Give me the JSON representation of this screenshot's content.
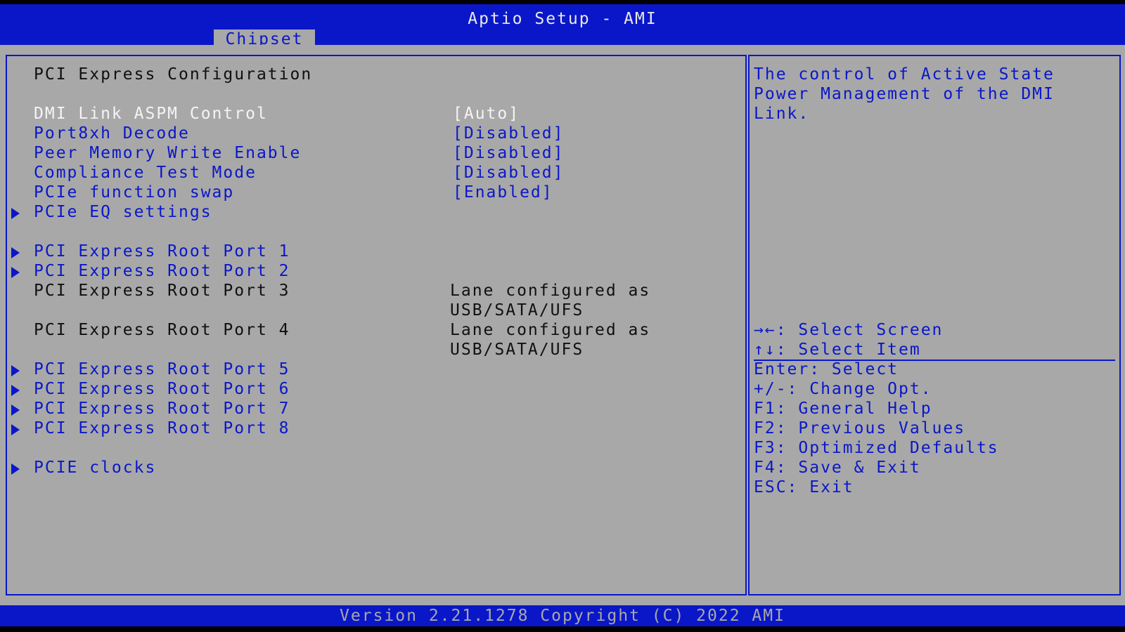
{
  "header": {
    "title": "Aptio Setup - AMI",
    "active_tab": "Chipset"
  },
  "page": {
    "heading": "PCI Express Configuration"
  },
  "settings": [
    {
      "label": "DMI Link ASPM Control",
      "value": "[Auto]"
    },
    {
      "label": "Port8xh Decode",
      "value": "[Disabled]"
    },
    {
      "label": "Peer Memory Write Enable",
      "value": "[Disabled]"
    },
    {
      "label": "Compliance Test Mode",
      "value": "[Disabled]"
    },
    {
      "label": "PCIe function swap",
      "value": "[Enabled]"
    }
  ],
  "submenus": {
    "eq_settings": "PCIe EQ settings",
    "port1": "PCI Express Root Port 1",
    "port2": "PCI Express Root Port 2",
    "port5": "PCI Express Root Port 5",
    "port6": "PCI Express Root Port 6",
    "port7": "PCI Express Root Port 7",
    "port8": "PCI Express Root Port 8",
    "clocks": "PCIE clocks"
  },
  "disabled_ports": [
    {
      "label": "PCI Express Root Port 3",
      "status_line1": "Lane configured as",
      "status_line2": "USB/SATA/UFS"
    },
    {
      "label": "PCI Express Root Port 4",
      "status_line1": "Lane configured as",
      "status_line2": "USB/SATA/UFS"
    }
  ],
  "help": {
    "lines": [
      "The control of Active State",
      "Power Management of the DMI",
      "Link."
    ]
  },
  "keys": [
    "→←: Select Screen",
    "↑↓: Select Item",
    "Enter: Select",
    "+/-: Change Opt.",
    "F1: General Help",
    "F2: Previous Values",
    "F3: Optimized Defaults",
    "F4: Save & Exit",
    "ESC: Exit"
  ],
  "footer": {
    "text": "Version 2.21.1278 Copyright (C) 2022 AMI"
  },
  "colors": {
    "blue": "#0a17c8",
    "gray": "#a8a8a8",
    "white": "#f4f4f4"
  }
}
